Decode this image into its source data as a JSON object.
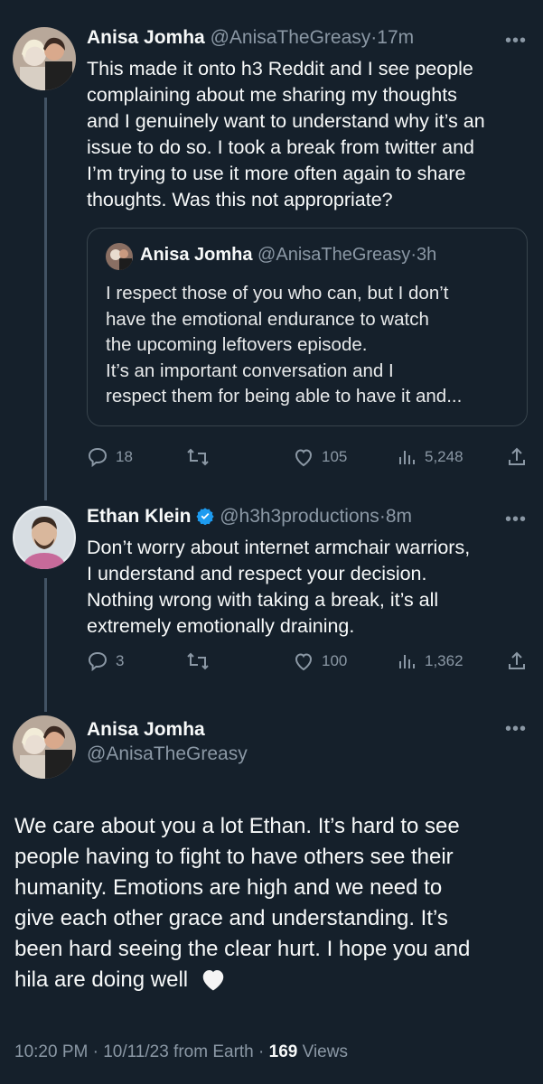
{
  "tweets": [
    {
      "name": "Anisa Jomha",
      "handle": "@AnisaTheGreasy",
      "sep": "·",
      "time": "17m",
      "more": "•••",
      "lines": [
        "This made it onto h3 Reddit and I see people",
        "complaining about me sharing my thoughts",
        "and I genuinely want to understand why it’s an",
        "issue to do so. I took a break from twitter and",
        "I’m trying to use it more often again to share",
        "thoughts. Was this not appropriate?"
      ],
      "quote": {
        "name": "Anisa Jomha",
        "handle": "@AnisaTheGreasy",
        "sep": "·",
        "time": "3h",
        "lines": [
          "I respect those of you who can, but I don’t",
          "have the emotional endurance to watch",
          "the upcoming leftovers episode.",
          "It’s an important conversation and I",
          "respect them for being able to have it and..."
        ]
      },
      "replies": "18",
      "retweets": "",
      "likes": "105",
      "views": "5,248"
    },
    {
      "name": "Ethan Klein",
      "handle": "@h3h3productions",
      "sep": "·",
      "time": "8m",
      "more": "•••",
      "verified_icon": "verified-badge-icon",
      "lines": [
        "Don’t worry about internet armchair warriors,",
        "I understand and respect your decision.",
        "Nothing wrong with taking a break, it’s all",
        "extremely emotionally draining."
      ],
      "replies": "3",
      "retweets": "",
      "likes": "100",
      "views": "1,362"
    }
  ],
  "main": {
    "name": "Anisa Jomha",
    "handle": "@AnisaTheGreasy",
    "more": "•••",
    "lines": [
      "We care about you a lot Ethan. It’s hard to see",
      "people having to fight to have others see their",
      "humanity. Emotions are high and we need to",
      "give each other grace and understanding. It’s",
      "been hard seeing the clear hurt. I hope you and",
      "hila are doing well"
    ],
    "emoji": "🤍",
    "time": "10:20 PM",
    "sep1": "·",
    "date": "10/11/23 from Earth",
    "sep2": "·",
    "views_count": "169",
    "views_label": "Views"
  },
  "colors": {
    "background": "#15202b",
    "text": "#f7f9f9",
    "muted": "#8b98a5",
    "verified": "#1d9bf0",
    "border": "#38444d"
  }
}
